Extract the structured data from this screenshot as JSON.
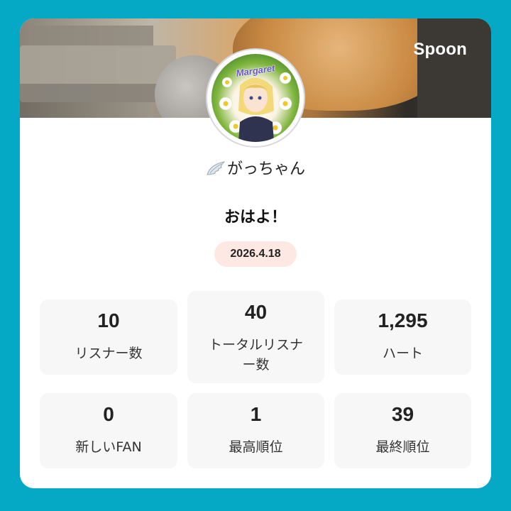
{
  "brand": "Spoon",
  "user": {
    "name": "がっちゃん",
    "badge_icon": "wing-icon"
  },
  "avatar": {
    "text": "Margaret"
  },
  "post": {
    "title": "おはよ！",
    "date": "2026.4.18"
  },
  "stats": [
    {
      "value": "10",
      "label": "リスナー数"
    },
    {
      "value": "40",
      "label": "トータルリスナー数"
    },
    {
      "value": "1,295",
      "label": "ハート"
    },
    {
      "value": "0",
      "label": "新しいFAN"
    },
    {
      "value": "1",
      "label": "最高順位"
    },
    {
      "value": "39",
      "label": "最終順位"
    }
  ],
  "colors": {
    "background": "#05a9c6",
    "card": "#ffffff",
    "stat_box": "#f7f7f7",
    "date_pill": "#fde8e3"
  }
}
